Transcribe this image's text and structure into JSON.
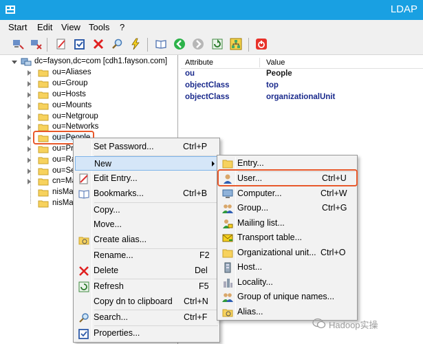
{
  "window": {
    "title": "LDAP"
  },
  "menubar": {
    "items": [
      "Start",
      "Edit",
      "View",
      "Tools",
      "?"
    ]
  },
  "tree": {
    "root": "dc=fayson,dc=com [cdh1.fayson.com]",
    "items": [
      "ou=Aliases",
      "ou=Group",
      "ou=Hosts",
      "ou=Mounts",
      "ou=Netgroup",
      "ou=Networks",
      "ou=People",
      "ou=Pr",
      "ou=Ra",
      "ou=Se",
      "cn=Ma",
      "nisMap",
      "nisMap"
    ]
  },
  "attributes": {
    "headers": [
      "Attribute",
      "Value"
    ],
    "rows": [
      {
        "attribute": "ou",
        "value": "People"
      },
      {
        "attribute": "objectClass",
        "value": "top"
      },
      {
        "attribute": "objectClass",
        "value": "organizationalUnit"
      }
    ]
  },
  "context_menu": {
    "items": [
      {
        "label": "Set Password...",
        "shortcut": "Ctrl+P"
      },
      {
        "label": "New",
        "shortcut": ""
      },
      {
        "label": "Edit Entry...",
        "shortcut": ""
      },
      {
        "label": "Bookmarks...",
        "shortcut": "Ctrl+B"
      },
      {
        "label": "Copy...",
        "shortcut": ""
      },
      {
        "label": "Move...",
        "shortcut": ""
      },
      {
        "label": "Create alias...",
        "shortcut": ""
      },
      {
        "label": "Rename...",
        "shortcut": "F2"
      },
      {
        "label": "Delete",
        "shortcut": "Del"
      },
      {
        "label": "Refresh",
        "shortcut": "F5"
      },
      {
        "label": "Copy dn to clipboard",
        "shortcut": "Ctrl+N"
      },
      {
        "label": "Search...",
        "shortcut": "Ctrl+F"
      },
      {
        "label": "Properties...",
        "shortcut": ""
      }
    ]
  },
  "new_submenu": {
    "items": [
      {
        "label": "Entry...",
        "shortcut": ""
      },
      {
        "label": "User...",
        "shortcut": "Ctrl+U"
      },
      {
        "label": "Computer...",
        "shortcut": "Ctrl+W"
      },
      {
        "label": "Group...",
        "shortcut": "Ctrl+G"
      },
      {
        "label": "Mailing list...",
        "shortcut": ""
      },
      {
        "label": "Transport table...",
        "shortcut": ""
      },
      {
        "label": "Organizational unit...",
        "shortcut": "Ctrl+O"
      },
      {
        "label": "Host...",
        "shortcut": ""
      },
      {
        "label": "Locality...",
        "shortcut": ""
      },
      {
        "label": "Group of unique names...",
        "shortcut": ""
      },
      {
        "label": "Alias...",
        "shortcut": ""
      }
    ]
  },
  "watermark": "Hadoop实操",
  "colors": {
    "titlebar": "#19a0e2",
    "highlight_box": "#e8582a",
    "attribute_text": "#1a2a8c",
    "menu_hover": "#d5e6f8"
  }
}
